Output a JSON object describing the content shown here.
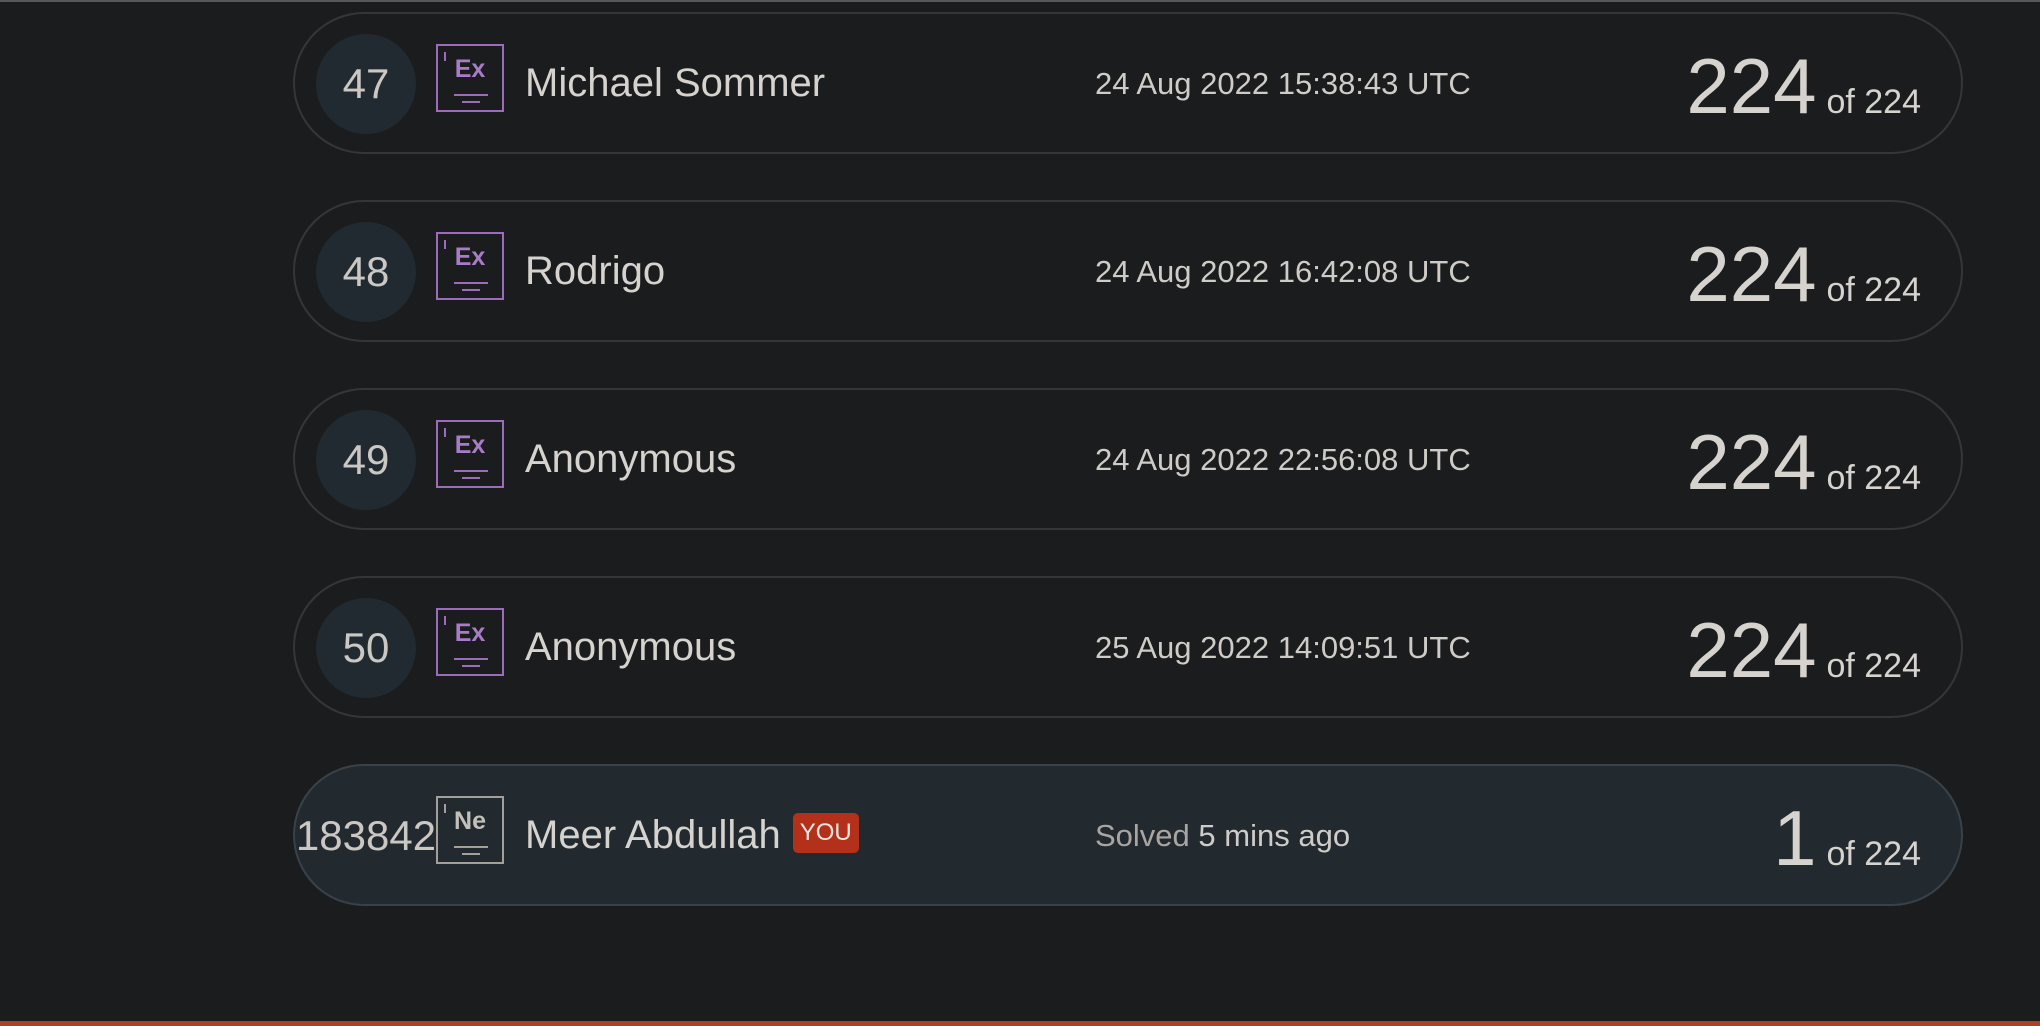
{
  "leaderboard": {
    "rows": [
      {
        "rank": "47",
        "element": "Ex",
        "name": "Michael Sommer",
        "time": "24 Aug 2022 15:38:43 UTC",
        "score": "224",
        "total": "of 224"
      },
      {
        "rank": "48",
        "element": "Ex",
        "name": "Rodrigo",
        "time": "24 Aug 2022 16:42:08 UTC",
        "score": "224",
        "total": "of 224"
      },
      {
        "rank": "49",
        "element": "Ex",
        "name": "Anonymous",
        "time": "24 Aug 2022 22:56:08 UTC",
        "score": "224",
        "total": "of 224"
      },
      {
        "rank": "50",
        "element": "Ex",
        "name": "Anonymous",
        "time": "25 Aug 2022 14:09:51 UTC",
        "score": "224",
        "total": "of 224"
      }
    ],
    "current_user": {
      "rank": "183842",
      "element": "Ne",
      "name": "Meer Abdullah",
      "badge": "YOU",
      "time_prefix": "Solved",
      "time": "5 mins ago",
      "score": "1",
      "total": "of 224"
    }
  },
  "colors": {
    "background": "#1b1c1e",
    "expert_purple": "#9d6bbb",
    "you_badge": "#b3311a",
    "bottom_bar": "#b0401f"
  }
}
